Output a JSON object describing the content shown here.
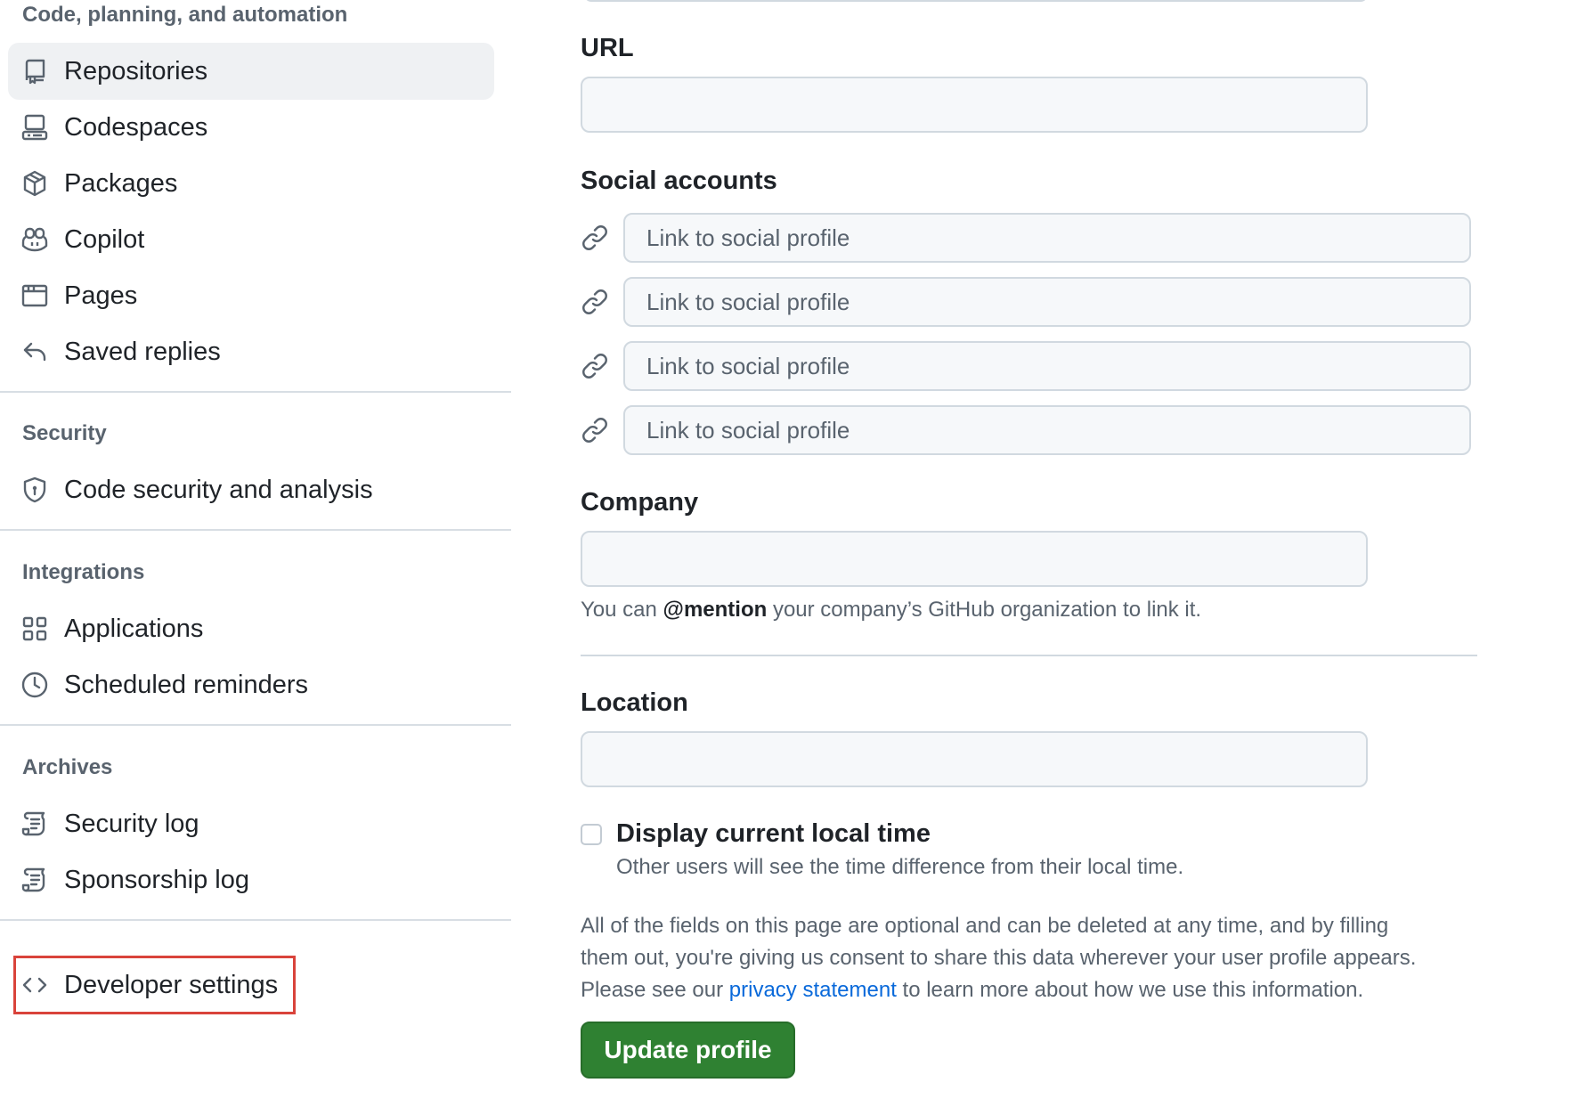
{
  "sidebar": {
    "sections": [
      {
        "heading": "Code, planning, and automation",
        "items": [
          {
            "label": "Repositories",
            "icon": "repo-icon",
            "selected": true
          },
          {
            "label": "Codespaces",
            "icon": "codespaces-icon"
          },
          {
            "label": "Packages",
            "icon": "package-icon"
          },
          {
            "label": "Copilot",
            "icon": "copilot-icon"
          },
          {
            "label": "Pages",
            "icon": "browser-icon"
          },
          {
            "label": "Saved replies",
            "icon": "reply-icon"
          }
        ]
      },
      {
        "heading": "Security",
        "items": [
          {
            "label": "Code security and analysis",
            "icon": "shield-lock-icon"
          }
        ]
      },
      {
        "heading": "Integrations",
        "items": [
          {
            "label": "Applications",
            "icon": "apps-icon"
          },
          {
            "label": "Scheduled reminders",
            "icon": "clock-icon"
          }
        ]
      },
      {
        "heading": "Archives",
        "items": [
          {
            "label": "Security log",
            "icon": "log-icon"
          },
          {
            "label": "Sponsorship log",
            "icon": "log-icon"
          }
        ]
      }
    ],
    "developer_settings": {
      "label": "Developer settings",
      "icon": "code-icon"
    }
  },
  "form": {
    "url": {
      "label": "URL",
      "value": ""
    },
    "social_accounts": {
      "label": "Social accounts",
      "placeholder": "Link to social profile",
      "icon": "link-icon",
      "fields": [
        "",
        "",
        "",
        ""
      ]
    },
    "company": {
      "label": "Company",
      "value": "",
      "help_prefix": "You can",
      "help_mention": "@mention",
      "help_suffix": "your company’s GitHub organization to link it."
    },
    "location": {
      "label": "Location",
      "value": ""
    },
    "local_time": {
      "label": "Display current local time",
      "note": "Other users will see the time difference from their local time.",
      "checked": false
    },
    "notice": {
      "line1": "All of the fields on this page are optional and can be deleted at any time, and by filling",
      "line2": "them out, you're giving us consent to share this data wherever your user profile appears.",
      "line3_prefix": "Please see our",
      "link_text": "privacy statement",
      "line3_suffix": "to learn more about how we use this information."
    },
    "submit_label": "Update profile"
  },
  "colors": {
    "accent_green": "#2f8132",
    "link_blue": "#0969da",
    "highlight_red": "#d9433b",
    "selected_bg": "#eff1f3"
  }
}
